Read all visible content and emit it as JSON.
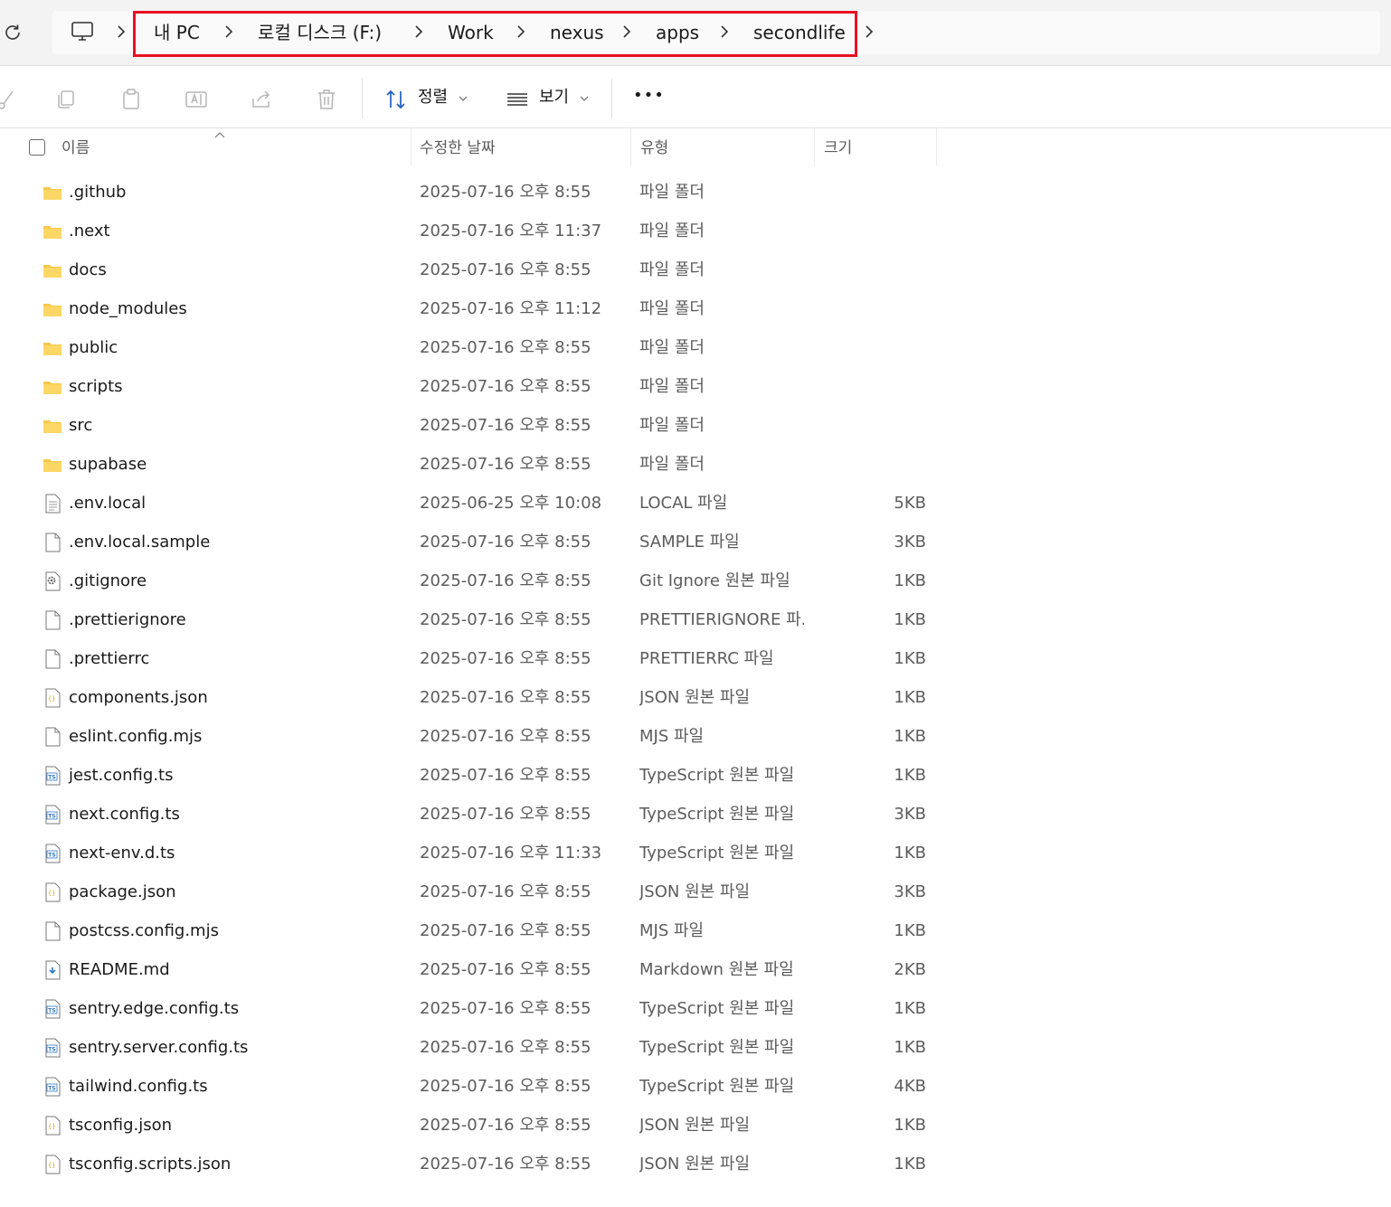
{
  "breadcrumb": {
    "items": [
      "내 PC",
      "로컬 디스크 (F:)",
      "Work",
      "nexus",
      "apps",
      "secondlife"
    ]
  },
  "toolbar": {
    "sort_label": "정렬",
    "view_label": "보기",
    "more_label": "•••"
  },
  "columns": {
    "name": "이름",
    "date": "수정한 날짜",
    "type": "유형",
    "size": "크기"
  },
  "files": [
    {
      "name": ".github",
      "date": "2025-07-16 오후 8:55",
      "type": "파일 폴더",
      "size": "",
      "icon": "folder-icon"
    },
    {
      "name": ".next",
      "date": "2025-07-16 오후 11:37",
      "type": "파일 폴더",
      "size": "",
      "icon": "folder-icon"
    },
    {
      "name": "docs",
      "date": "2025-07-16 오후 8:55",
      "type": "파일 폴더",
      "size": "",
      "icon": "folder-icon"
    },
    {
      "name": "node_modules",
      "date": "2025-07-16 오후 11:12",
      "type": "파일 폴더",
      "size": "",
      "icon": "folder-icon"
    },
    {
      "name": "public",
      "date": "2025-07-16 오후 8:55",
      "type": "파일 폴더",
      "size": "",
      "icon": "folder-icon"
    },
    {
      "name": "scripts",
      "date": "2025-07-16 오후 8:55",
      "type": "파일 폴더",
      "size": "",
      "icon": "folder-icon"
    },
    {
      "name": "src",
      "date": "2025-07-16 오후 8:55",
      "type": "파일 폴더",
      "size": "",
      "icon": "folder-icon"
    },
    {
      "name": "supabase",
      "date": "2025-07-16 오후 8:55",
      "type": "파일 폴더",
      "size": "",
      "icon": "folder-icon"
    },
    {
      "name": ".env.local",
      "date": "2025-06-25 오후 10:08",
      "type": "LOCAL 파일",
      "size": "5KB",
      "icon": "text-file-icon"
    },
    {
      "name": ".env.local.sample",
      "date": "2025-07-16 오후 8:55",
      "type": "SAMPLE 파일",
      "size": "3KB",
      "icon": "blank-file-icon"
    },
    {
      "name": ".gitignore",
      "date": "2025-07-16 오후 8:55",
      "type": "Git Ignore 원본 파일",
      "size": "1KB",
      "icon": "settings-file-icon"
    },
    {
      "name": ".prettierignore",
      "date": "2025-07-16 오후 8:55",
      "type": "PRETTIERIGNORE 파...",
      "size": "1KB",
      "icon": "blank-file-icon"
    },
    {
      "name": ".prettierrc",
      "date": "2025-07-16 오후 8:55",
      "type": "PRETTIERRC 파일",
      "size": "1KB",
      "icon": "blank-file-icon"
    },
    {
      "name": "components.json",
      "date": "2025-07-16 오후 8:55",
      "type": "JSON 원본 파일",
      "size": "1KB",
      "icon": "json-file-icon"
    },
    {
      "name": "eslint.config.mjs",
      "date": "2025-07-16 오후 8:55",
      "type": "MJS 파일",
      "size": "1KB",
      "icon": "blank-file-icon"
    },
    {
      "name": "jest.config.ts",
      "date": "2025-07-16 오후 8:55",
      "type": "TypeScript 원본 파일",
      "size": "1KB",
      "icon": "ts-file-icon"
    },
    {
      "name": "next.config.ts",
      "date": "2025-07-16 오후 8:55",
      "type": "TypeScript 원본 파일",
      "size": "3KB",
      "icon": "ts-file-icon"
    },
    {
      "name": "next-env.d.ts",
      "date": "2025-07-16 오후 11:33",
      "type": "TypeScript 원본 파일",
      "size": "1KB",
      "icon": "ts-file-icon"
    },
    {
      "name": "package.json",
      "date": "2025-07-16 오후 8:55",
      "type": "JSON 원본 파일",
      "size": "3KB",
      "icon": "json-file-icon"
    },
    {
      "name": "postcss.config.mjs",
      "date": "2025-07-16 오후 8:55",
      "type": "MJS 파일",
      "size": "1KB",
      "icon": "blank-file-icon"
    },
    {
      "name": "README.md",
      "date": "2025-07-16 오후 8:55",
      "type": "Markdown 원본 파일",
      "size": "2KB",
      "icon": "markdown-file-icon"
    },
    {
      "name": "sentry.edge.config.ts",
      "date": "2025-07-16 오후 8:55",
      "type": "TypeScript 원본 파일",
      "size": "1KB",
      "icon": "ts-file-icon"
    },
    {
      "name": "sentry.server.config.ts",
      "date": "2025-07-16 오후 8:55",
      "type": "TypeScript 원본 파일",
      "size": "1KB",
      "icon": "ts-file-icon"
    },
    {
      "name": "tailwind.config.ts",
      "date": "2025-07-16 오후 8:55",
      "type": "TypeScript 원본 파일",
      "size": "4KB",
      "icon": "ts-file-icon"
    },
    {
      "name": "tsconfig.json",
      "date": "2025-07-16 오후 8:55",
      "type": "JSON 원본 파일",
      "size": "1KB",
      "icon": "json-file-icon"
    },
    {
      "name": "tsconfig.scripts.json",
      "date": "2025-07-16 오후 8:55",
      "type": "JSON 원본 파일",
      "size": "1KB",
      "icon": "json-file-icon"
    }
  ],
  "colors": {
    "highlight": "#e81123",
    "folder": "#f8c84a",
    "ts_badge": "#3178c6",
    "json_badge": "#c9a227"
  }
}
